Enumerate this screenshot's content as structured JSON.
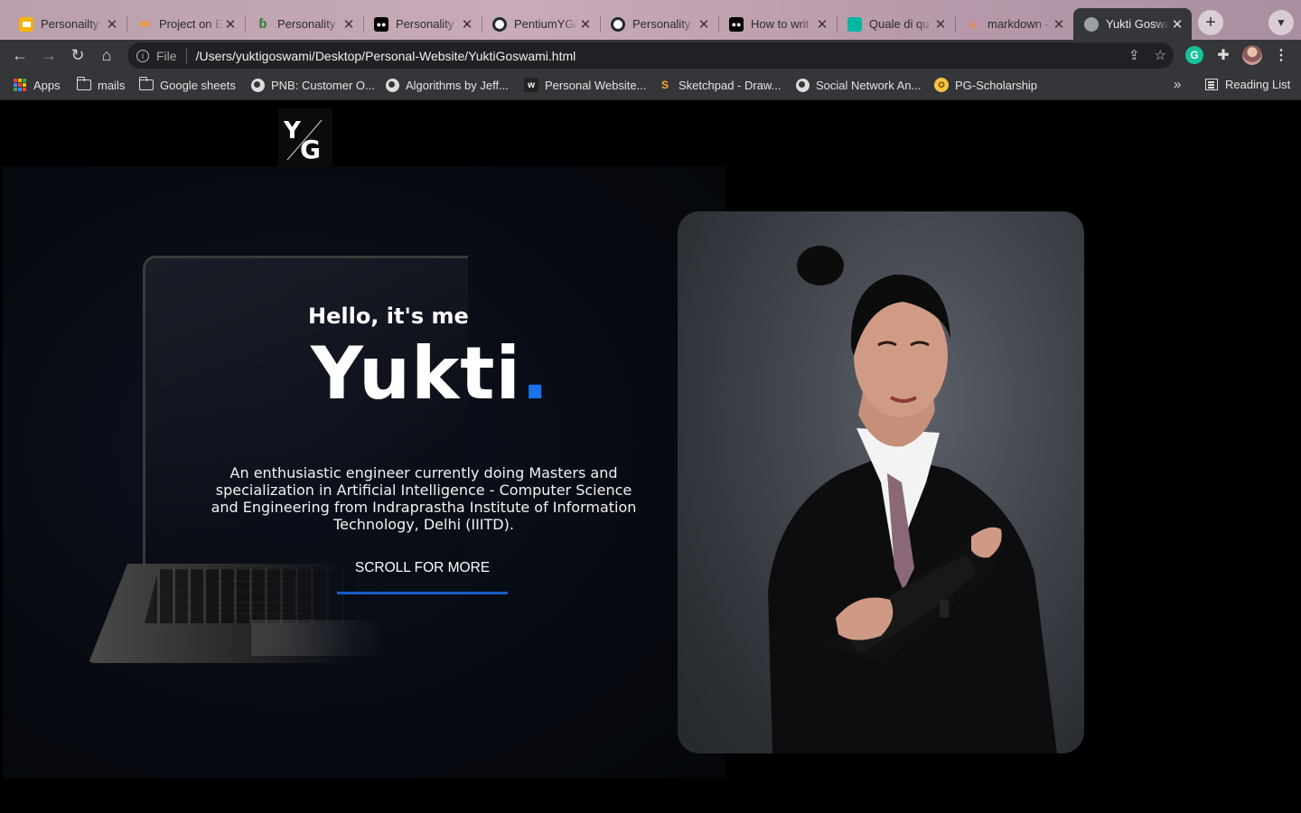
{
  "browser": {
    "tabs": [
      {
        "title": "Personailty",
        "icon": "slides-icon",
        "color": "#f4b400"
      },
      {
        "title": "Project on E",
        "icon": "infinity-icon",
        "color": "#ff9800"
      },
      {
        "title": "Personality",
        "icon": "leaf-icon",
        "color": "#2e7d32"
      },
      {
        "title": "Personality",
        "icon": "medium-icon",
        "color": "#000000"
      },
      {
        "title": "PentiumYG/",
        "icon": "github-icon",
        "color": "#24292e"
      },
      {
        "title": "Personality",
        "icon": "github-icon",
        "color": "#24292e"
      },
      {
        "title": "How to writ",
        "icon": "medium-icon",
        "color": "#000000"
      },
      {
        "title": "Quale di qu",
        "icon": "book-icon",
        "color": "#00b89f"
      },
      {
        "title": "markdown -",
        "icon": "stackoverflow-icon",
        "color": "#f48024"
      },
      {
        "title": "Yukti Goswa",
        "icon": "globe-icon",
        "color": "#9aa0a6",
        "active": true
      }
    ],
    "new_tab_label": "+",
    "url_scheme": "File",
    "url": "/Users/yuktigoswami/Desktop/Personal-Website/YuktiGoswami.html",
    "bookmarks": [
      {
        "label": "Apps",
        "icon": "apps-grid-icon"
      },
      {
        "label": "mails",
        "icon": "folder-icon"
      },
      {
        "label": "Google sheets",
        "icon": "folder-icon"
      },
      {
        "label": "PNB: Customer O...",
        "icon": "globe-icon"
      },
      {
        "label": "Algorithms by Jeff...",
        "icon": "globe-icon"
      },
      {
        "label": "Personal Website...",
        "icon": "wix-icon"
      },
      {
        "label": "Sketchpad - Draw...",
        "icon": "sketchpad-icon"
      },
      {
        "label": "Social Network An...",
        "icon": "globe-icon"
      },
      {
        "label": "PG-Scholarship",
        "icon": "emblem-icon"
      }
    ],
    "more_bookmarks": "»",
    "reading_list": "Reading List",
    "extension_letter": "G"
  },
  "site": {
    "logo_text": "YG",
    "greeting": "Hello, it's me",
    "name": "Yukti",
    "name_dot": ".",
    "bio": "An enthusiastic engineer currently doing Masters and specialization in Artificial Intelligence - Computer Science and Engineering from Indraprastha Institute of Information Technology, Delhi (IIITD).",
    "scroll_label": "SCROLL FOR MORE",
    "accent": "#1a73e8"
  }
}
